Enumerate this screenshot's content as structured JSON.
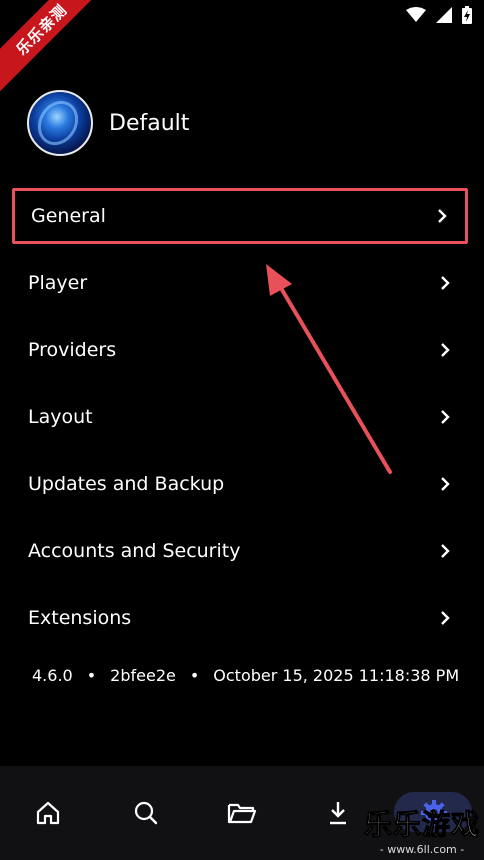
{
  "ribbon": {
    "text": "乐乐亲测"
  },
  "profile": {
    "name": "Default"
  },
  "menu": {
    "items": [
      {
        "label": "General"
      },
      {
        "label": "Player"
      },
      {
        "label": "Providers"
      },
      {
        "label": "Layout"
      },
      {
        "label": "Updates and Backup"
      },
      {
        "label": "Accounts and Security"
      },
      {
        "label": "Extensions"
      }
    ]
  },
  "version": {
    "number": "4.6.0",
    "separator": "•",
    "commit": "2bfee2e",
    "date": "October 15, 2025 11:18:38 PM"
  },
  "nav": {
    "items": [
      "home-icon",
      "search-icon",
      "folder-icon",
      "download-icon",
      "settings-icon"
    ]
  },
  "watermark": {
    "title": "乐乐游戏",
    "url": "- www.6ll.com -"
  },
  "colors": {
    "highlight": "#e8515a",
    "ribbon": "#c8161d",
    "nav_active": "#4a63e8"
  }
}
